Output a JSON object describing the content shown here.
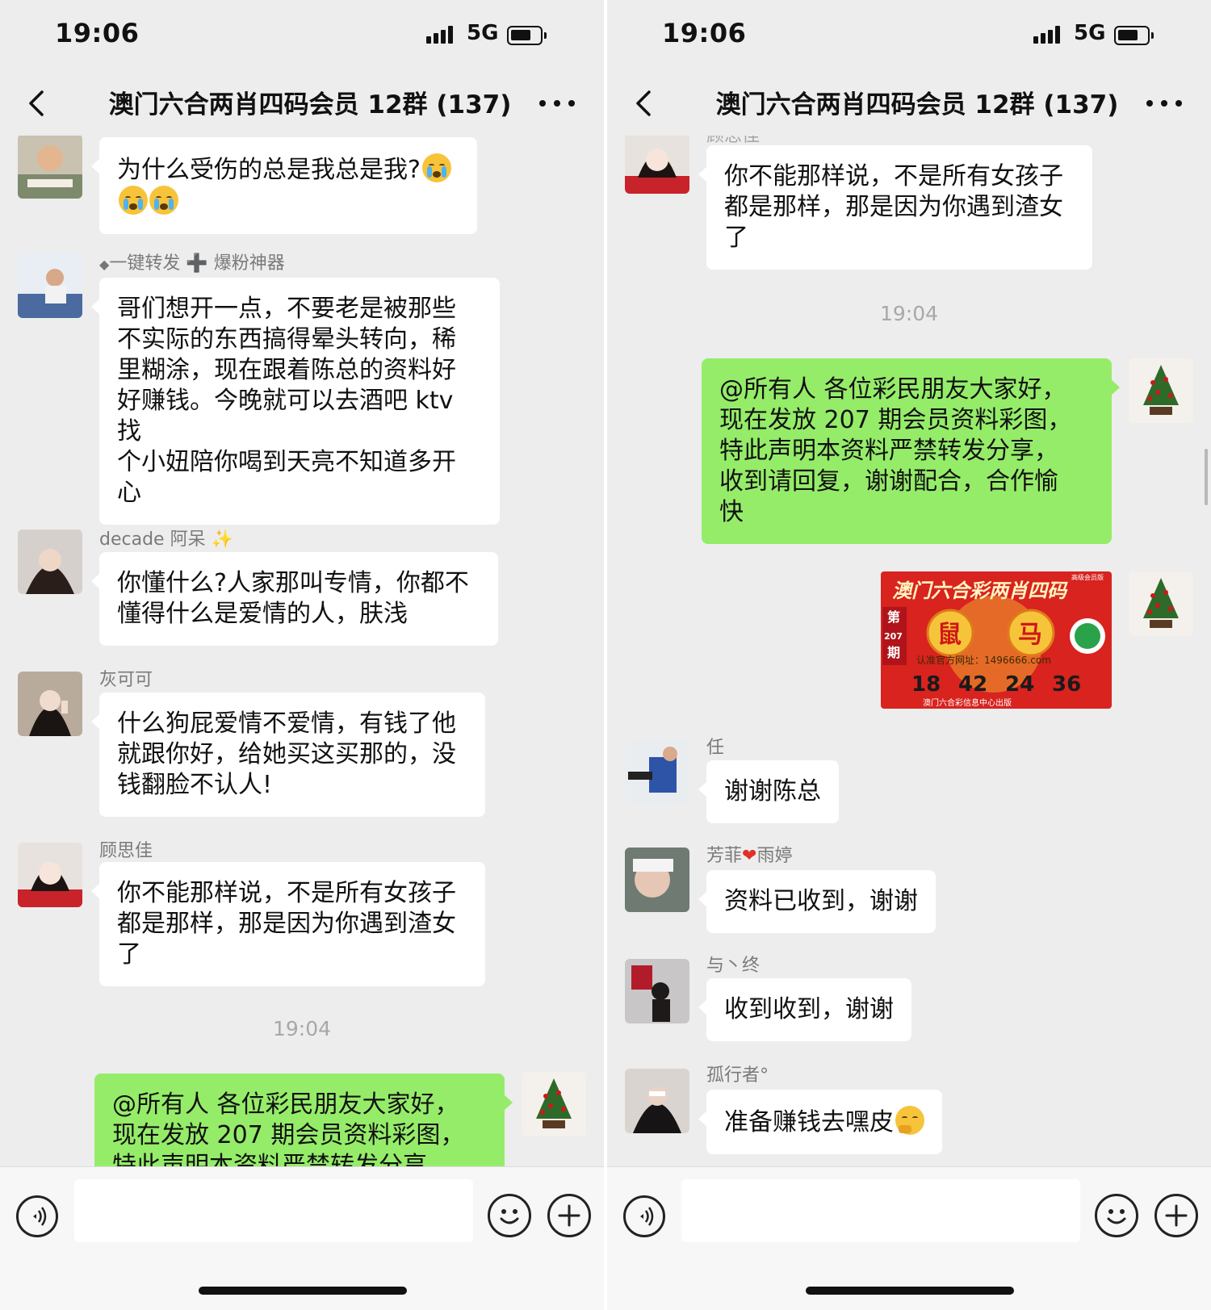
{
  "status_bar": {
    "time": "19:06",
    "network": "5G",
    "battery_level": 0.7
  },
  "nav": {
    "title": "澳门六合两肖四码会员 12群 (137)"
  },
  "left": {
    "messages": [
      {
        "sender": "",
        "lines": [
          "为什么受伤的总是我总是我?"
        ]
      },
      {
        "sender": "一键转发 ➕ 爆粉神器",
        "lines": [
          "哥们想开一点，不要老是被那些",
          "不实际的东西搞得晕头转向，稀",
          "里糊涂，现在跟着陈总的资料好",
          "好赚钱。今晚就可以去酒吧 ktv 找",
          "个小妞陪你喝到天亮不知道多开",
          "心"
        ]
      },
      {
        "sender": "decade 阿呆",
        "lines": [
          "你懂什么?人家那叫专情，你都不",
          "懂得什么是爱情的人，肤浅"
        ]
      },
      {
        "sender": "灰可可",
        "lines": [
          "什么狗屁爱情不爱情，有钱了他",
          "就跟你好，给她买这买那的，没",
          "钱翻脸不认人!"
        ]
      },
      {
        "sender": "顾思佳",
        "lines": [
          "你不能那样说，不是所有女孩子",
          "都是那样，那是因为你遇到渣女",
          "了"
        ]
      }
    ],
    "timestamp": "19:04",
    "own_message": [
      "@所有人  各位彩民朋友大家好，",
      "现在发放 207 期会员资料彩图，",
      "特此声明本资料严禁转发分享，"
    ]
  },
  "right": {
    "messages_top": [
      {
        "sender": "顾思佳",
        "lines": [
          "你不能那样说，不是所有女孩子",
          "都是那样，那是因为你遇到渣女",
          "了"
        ]
      }
    ],
    "timestamp": "19:04",
    "own_message": [
      "@所有人  各位彩民朋友大家好，",
      "现在发放 207 期会员资料彩图，",
      "特此声明本资料严禁转发分享，",
      "收到请回复，谢谢配合，合作愉",
      "快"
    ],
    "image": {
      "title": "澳门六合彩两肖四码",
      "corner_label": "高级会员版",
      "issue_prefix": "第",
      "issue_number": "207",
      "issue_suffix": "期",
      "zodiac": [
        "鼠",
        "马"
      ],
      "url": "认准官方网址：1496666.com",
      "numbers": [
        "18",
        "42",
        "24",
        "36"
      ],
      "footer": "澳门六合彩信息中心出版"
    },
    "messages_bottom": [
      {
        "sender": "任",
        "lines": [
          "谢谢陈总"
        ]
      },
      {
        "sender": "芳菲 雨婷",
        "lines": [
          "资料已收到，谢谢"
        ]
      },
      {
        "sender": "与丶终",
        "lines": [
          "收到收到，谢谢"
        ]
      },
      {
        "sender": "孤行者°",
        "lines": [
          "准备赚钱去嘿皮"
        ]
      }
    ]
  }
}
